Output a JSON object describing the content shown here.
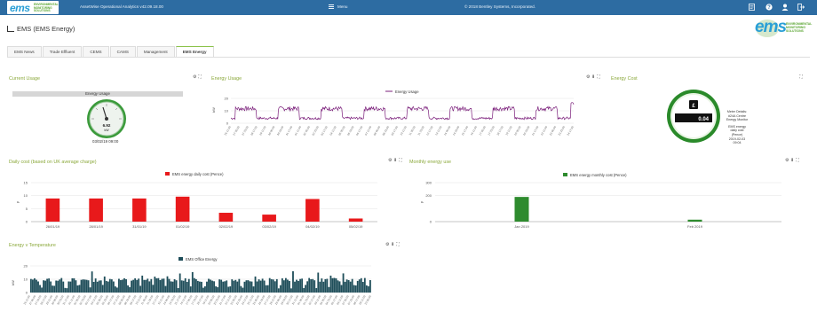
{
  "topbar": {
    "logo_text": "ems",
    "logo_sub": "ENVIRONMENTAL MONITORING SOLUTIONS",
    "title": "AssetWise Operational Analytics v42.09.18.00",
    "menu_label": "Menu",
    "copyright": "© 2018 Bentley Systems, Incorporated.",
    "icons": [
      "document-icon",
      "help-icon",
      "user-icon",
      "logout-icon"
    ]
  },
  "page": {
    "title": "EMS (EMS Energy)",
    "logo_text": "ems",
    "logo_sub": "ENVIRONMENTAL MONITORING SOLUTIONS"
  },
  "tabs": [
    {
      "label": "EMS News",
      "active": false
    },
    {
      "label": "Trade Effluent",
      "active": false
    },
    {
      "label": "CEMS",
      "active": false
    },
    {
      "label": "CAMS",
      "active": false
    },
    {
      "label": "Management",
      "active": false
    },
    {
      "label": "EMS Energy",
      "active": true
    }
  ],
  "panels": {
    "current_usage": {
      "title": "Current Usage",
      "gauge_title": "Energy Usage",
      "value": "6.92",
      "unit": "kW",
      "timestamp": "03/02/19 09:00"
    },
    "energy_usage": {
      "title": "Energy Usage",
      "legend": "Energy Usage",
      "ylabel": "kW"
    },
    "energy_cost": {
      "title": "Energy Cost",
      "symbol": "£",
      "value": "0.04",
      "label_meter": "Meter Details: #24A Centre Energy Monitor",
      "label_cost": "EMS energy daily cost (Pence)",
      "label_time": "2019-02-03 09:04"
    },
    "daily_cost": {
      "title": "Daily cost (based on UK average charge)",
      "legend": "EMS energy daily cost (Pence)"
    },
    "monthly_use": {
      "title": "Monthly energy use",
      "legend": "EMS energy monthly cost (Pence)"
    },
    "energy_temp": {
      "title": "Energy v Temperature",
      "legend": "EMS Office Energy",
      "ylabel": "kW"
    }
  },
  "colors": {
    "topbar": "#2d6ca2",
    "panel_title": "#8aa83a",
    "energy_line": "#7b1f7b",
    "daily_bars": "#e8191b",
    "monthly_bars": "#2e8b2e",
    "temp_area": "#1f4e5a"
  },
  "chart_data": [
    {
      "id": "daily",
      "type": "bar",
      "title": "Daily cost (based on UK average charge)",
      "categories": [
        "26/01/19",
        "28/01/19",
        "31/01/19",
        "01/02/19",
        "02/02/19",
        "03/02/19",
        "04/02/19",
        "05/02/19"
      ],
      "series": [
        {
          "name": "EMS energy daily cost (Pence)",
          "values": [
            8.9,
            8.9,
            8.9,
            9.6,
            3.4,
            2.7,
            8.7,
            1.2
          ]
        }
      ],
      "yticks": [
        "0",
        "5",
        "10",
        "15"
      ],
      "ylim": [
        0,
        15
      ],
      "ylabel": "p"
    },
    {
      "id": "monthly",
      "type": "bar",
      "title": "Monthly energy use",
      "categories": [
        "Jan 2019",
        "Feb 2019"
      ],
      "series": [
        {
          "name": "EMS energy monthly cost (Pence)",
          "values": [
            190,
            15
          ]
        }
      ],
      "yticks": [
        "0",
        "200",
        "300"
      ],
      "ylim": [
        0,
        300
      ],
      "ylabel": "p"
    },
    {
      "id": "energy",
      "type": "line",
      "title": "Energy Usage",
      "series": [
        {
          "name": "Energy Usage"
        }
      ],
      "yticks": [
        "0",
        "10",
        "20"
      ],
      "ylim": [
        0,
        20
      ],
      "ylabel": "kW",
      "xticks": [
        "26 11:00",
        "27 05:00",
        "27 23:00",
        "28 17:00",
        "29 11:00",
        "30 05:00",
        "30 23:00",
        "31 17:00",
        "01 11:00",
        "02 05:00",
        "02 23:00",
        "03 17:00",
        "04 11:00",
        "05 05:00",
        "05 23:00",
        "06 17:00",
        "07 11:00",
        "08 05:00",
        "08 23:00",
        "09 17:00",
        "10 11:00",
        "11 05:00",
        "11 23:00",
        "12 17:00",
        "13 11:00",
        "14 05:00",
        "14 23:00",
        "15 17:00",
        "16 11:00",
        "17 05:00",
        "17 23:00",
        "18 17:00",
        "19 11:00",
        "20 05:00",
        "20 23:00",
        "21 17:00",
        "22 11:00",
        "23 05:00",
        "23 23:00",
        "24 17:00"
      ]
    },
    {
      "id": "temp",
      "type": "area",
      "title": "Energy v Temperature",
      "series": [
        {
          "name": "EMS Office Energy"
        }
      ],
      "yticks": [
        "0",
        "10",
        "20"
      ],
      "ylim": [
        0,
        20
      ],
      "ylabel": "kW",
      "xticks": [
        "26 11:00",
        "27 05:00",
        "27 23:00",
        "28 17:00",
        "29 11:00",
        "30 05:00",
        "30 23:00",
        "31 17:00",
        "01 11:00",
        "02 05:00",
        "02 23:00",
        "03 17:00",
        "04 11:00",
        "05 05:00",
        "05 23:00",
        "06 17:00",
        "07 11:00",
        "08 05:00",
        "08 23:00",
        "09 17:00",
        "10 11:00",
        "11 05:00",
        "11 23:00",
        "12 17:00",
        "13 11:00",
        "14 05:00",
        "14 23:00",
        "15 17:00",
        "16 11:00",
        "17 05:00",
        "17 23:00",
        "18 17:00",
        "19 11:00",
        "20 05:00",
        "20 23:00",
        "21 17:00",
        "22 11:00",
        "23 05:00",
        "23 23:00",
        "24 17:00",
        "25 11:00",
        "26 05:00",
        "26 23:00",
        "27 17:00",
        "28 11:00",
        "29 05:00",
        "29 23:00",
        "30 17:00",
        "31 11:00",
        "01 05:00",
        "01 23:00",
        "02 17:00",
        "03 11:00",
        "04 05:00",
        "04 23:00",
        "05 17:00",
        "06 11:00",
        "07 05:00",
        "07 23:00",
        "08 17:00",
        "09 11:00",
        "10 05:00"
      ]
    }
  ]
}
